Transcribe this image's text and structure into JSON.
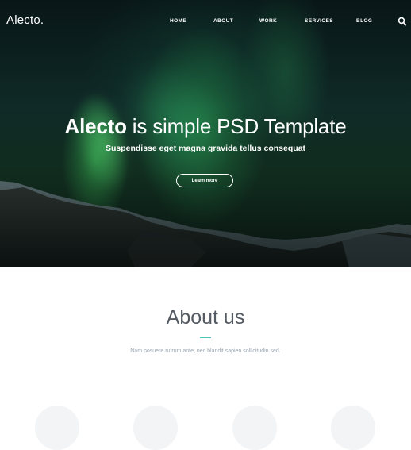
{
  "brand": {
    "logo_text": "Alecto."
  },
  "nav": {
    "items": [
      {
        "label": "HOME"
      },
      {
        "label": "ABOUT"
      },
      {
        "label": "WORK"
      },
      {
        "label": "SERVICES"
      },
      {
        "label": "BLOG"
      }
    ],
    "search_icon": "search-icon"
  },
  "hero": {
    "title_bold": "Alecto",
    "title_rest": " is simple PSD Template",
    "subtitle": "Suspendisse eget magna gravida tellus consequat",
    "button_label": "Learn more"
  },
  "about": {
    "title": "About us",
    "text": "Nam posuere rutrum ante, nec blandit sapien sollicitudin sed.",
    "accent_color": "#48c6b8"
  }
}
